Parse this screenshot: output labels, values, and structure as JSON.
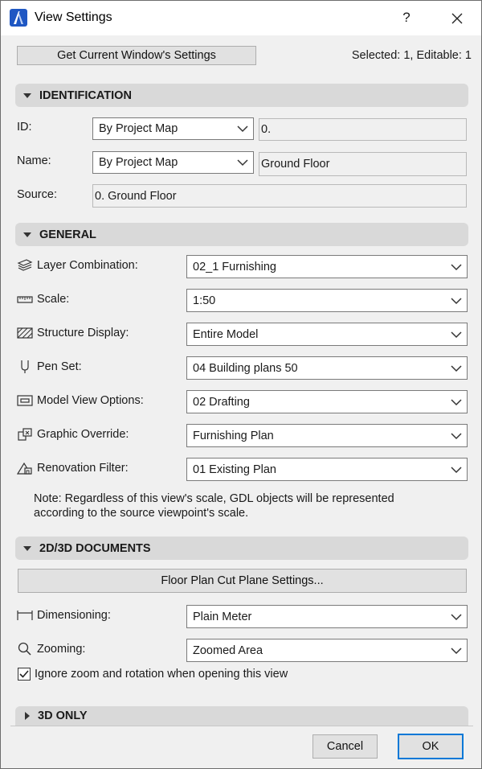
{
  "window": {
    "title": "View Settings",
    "help": "?",
    "selected_info": "Selected: 1, Editable: 1"
  },
  "top": {
    "get_settings_label": "Get Current Window's Settings"
  },
  "identification": {
    "header": "IDENTIFICATION",
    "id_label": "ID:",
    "id_mode": "By Project Map",
    "id_value": "0.",
    "name_label": "Name:",
    "name_mode": "By Project Map",
    "name_value": "Ground Floor",
    "source_label": "Source:",
    "source_value": "0. Ground Floor"
  },
  "general": {
    "header": "GENERAL",
    "rows": [
      {
        "label": "Layer Combination:",
        "value": "02_1 Furnishing",
        "icon": "layers-icon"
      },
      {
        "label": "Scale:",
        "value": "1:50",
        "icon": "ruler-icon"
      },
      {
        "label": "Structure Display:",
        "value": "Entire Model",
        "icon": "hatch-icon"
      },
      {
        "label": "Pen Set:",
        "value": "04 Building plans 50",
        "icon": "pen-icon"
      },
      {
        "label": "Model View Options:",
        "value": "02 Drafting",
        "icon": "model-view-icon"
      },
      {
        "label": "Graphic Override:",
        "value": "Furnishing Plan",
        "icon": "graphic-override-icon"
      },
      {
        "label": "Renovation Filter:",
        "value": "01 Existing Plan",
        "icon": "renovation-icon"
      }
    ],
    "note_line1": "Note: Regardless of this view's scale, GDL objects will be represented",
    "note_line2": "according to the source viewpoint's scale."
  },
  "documents": {
    "header": "2D/3D DOCUMENTS",
    "cut_plane_label": "Floor Plan Cut Plane Settings...",
    "dimensioning_label": "Dimensioning:",
    "dimensioning_value": "Plain Meter",
    "zooming_label": "Zooming:",
    "zooming_value": "Zoomed Area",
    "ignore_zoom_label": "Ignore zoom and rotation when opening this view",
    "ignore_zoom_checked": true
  },
  "only3d": {
    "header": "3D ONLY"
  },
  "footer": {
    "cancel_label": "Cancel",
    "ok_label": "OK"
  },
  "colors": {
    "section_bg": "#d9d9d9",
    "ok_border": "#0078d7",
    "dialog_bg": "#f0f0f0"
  }
}
